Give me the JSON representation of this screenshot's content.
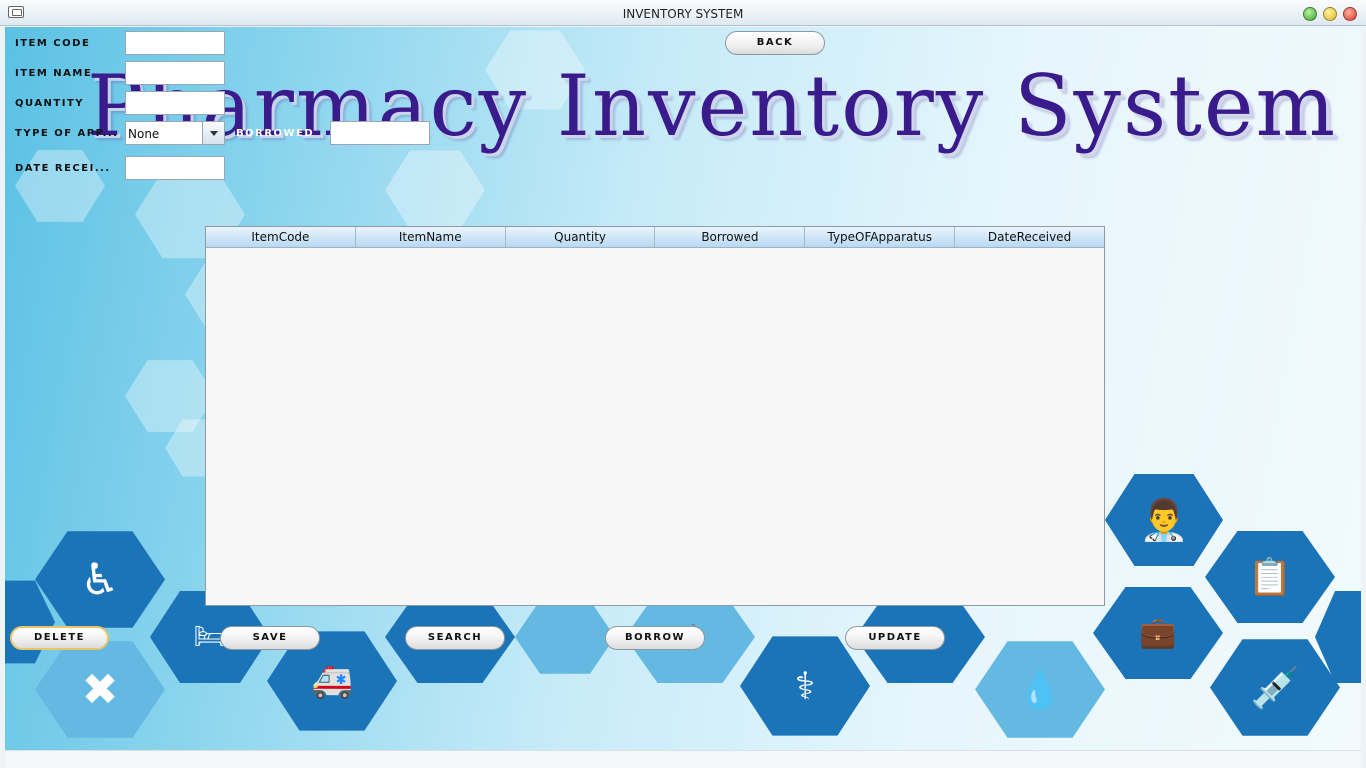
{
  "window": {
    "title": "INVENTORY SYSTEM"
  },
  "heading": "Pharmacy  Inventory  System",
  "form": {
    "item_code_label": "ITEM CODE",
    "item_name_label": "ITEM NAME",
    "quantity_label": "QUANTITY",
    "type_label": "TYPE OF APP...",
    "borrowed_label": "BORROWED",
    "date_label": "DATE RECEI...",
    "item_code_value": "",
    "item_name_value": "",
    "quantity_value": "",
    "type_selected": "None",
    "borrowed_value": "",
    "date_value": ""
  },
  "buttons": {
    "back": "BACK",
    "delete": "DELETE",
    "save": "SAVE",
    "search": "SEARCH",
    "borrow": "BORROW",
    "update": "UPDATE"
  },
  "table": {
    "columns": [
      "ItemCode",
      "ItemName",
      "Quantity",
      "Borrowed",
      "TypeOFApparatus",
      "DateReceived"
    ],
    "rows": []
  },
  "icons": [
    "wheelchair-icon",
    "hospital-bed-icon",
    "bandage-icon",
    "ambulance-icon",
    "flask-icon",
    "microscope-icon",
    "stethoscope-icon",
    "first-aid-kit-icon",
    "drops-icon",
    "doctor-icon",
    "clipboard-icon",
    "medical-bag-icon",
    "syringe-icon"
  ],
  "colors": {
    "heading": "#3a1b8c",
    "hex_dark": "#1b73b8",
    "button_focus": "#e9c56a"
  }
}
